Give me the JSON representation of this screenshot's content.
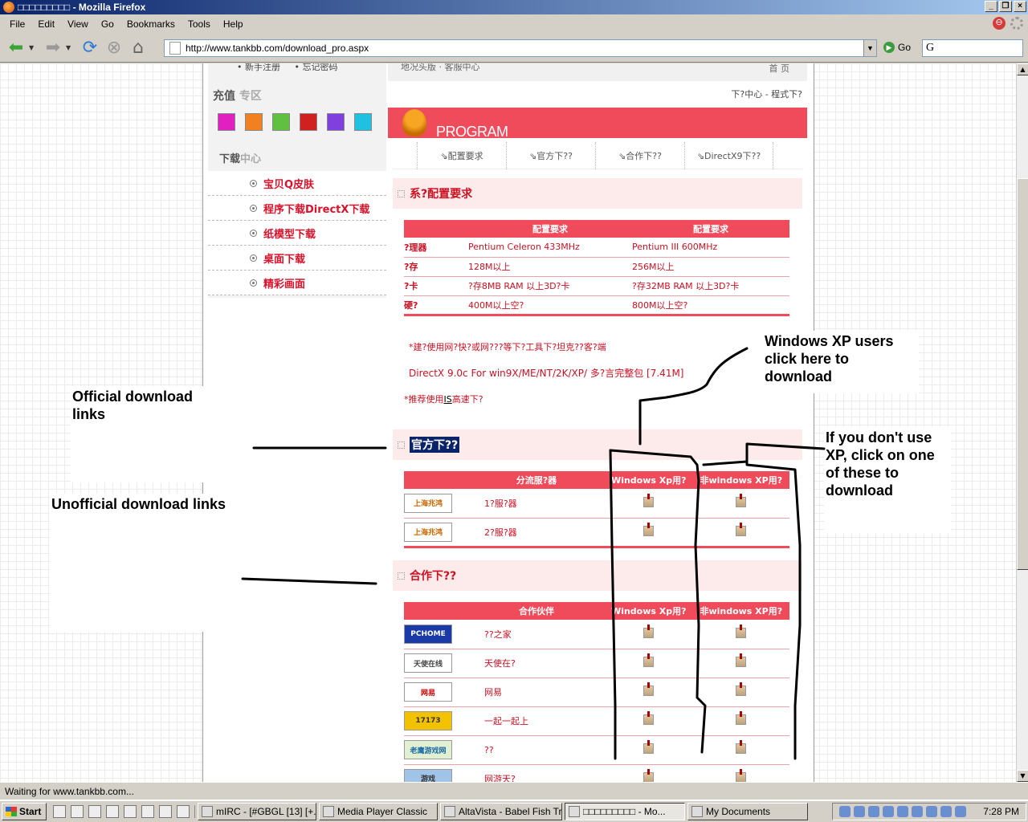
{
  "window": {
    "title": "□□□□□□□□□ - Mozilla Firefox"
  },
  "menu": {
    "items": [
      "File",
      "Edit",
      "View",
      "Go",
      "Bookmarks",
      "Tools",
      "Help"
    ]
  },
  "toolbar": {
    "url": "http://www.tankbb.com/download_pro.aspx",
    "go_label": "Go",
    "search_value": "G"
  },
  "sidebar": {
    "top_links": [
      "新手注册",
      "忘记密码"
    ],
    "recharge_title": "充值",
    "recharge_zone": "专区",
    "download_title": "下载",
    "download_title_cn": "中心",
    "items": [
      "宝贝Q皮肤",
      "程序下载DirectX下载",
      "纸模型下载",
      "桌面下载",
      "精彩画面"
    ]
  },
  "main": {
    "top_left": "地况头版 · 客服中心",
    "top_right": "首  页",
    "breadcrumb": "下?中心 - 程式下?",
    "banner_label": "PROGRAM",
    "tabs": [
      "配置要求",
      "官方下??",
      "合作下??",
      "DirectX9下??"
    ],
    "sec1_title": "系?配置要求",
    "sec1_headers": [
      "",
      "配置要求",
      "配置要求"
    ],
    "sec1_rows": [
      [
        "?理器",
        "Pentium Celeron 433MHz",
        "Pentium III 600MHz"
      ],
      [
        "?存",
        "128M以上",
        "256M以上"
      ],
      [
        "?卡",
        "?存8MB RAM 以上3D?卡",
        "?存32MB RAM 以上3D?卡"
      ],
      [
        "硬?",
        "400M以上空?",
        "800M以上空?"
      ]
    ],
    "note1": "*建?使用网?快?或网???等下?工具下?坦克??客?端",
    "note2": "DirectX 9.0c For win9X/ME/NT/2K/XP/ 多?言完整包 [7.41M]",
    "note3_pre": "*推荐使用",
    "note3_link": "IS",
    "note3_post": "高速下?",
    "sec2_title": "官方下??",
    "sec2_headers": [
      "",
      "分流服?器",
      "Windows Xp用?",
      "非windows XP用?"
    ],
    "sec2_rows": [
      {
        "logo": "上海兆鸿",
        "name": "1?服?器"
      },
      {
        "logo": "上海兆鸿",
        "name": "2?服?器"
      }
    ],
    "sec3_title": "合作下??",
    "sec3_headers": [
      "",
      "合作伙伴",
      "Windows Xp用?",
      "非windows XP用?"
    ],
    "sec3_rows": [
      {
        "logo": "PCHOME",
        "name": "??之家"
      },
      {
        "logo": "天使在线",
        "name": "天使在?"
      },
      {
        "logo": "网易",
        "name": "网易"
      },
      {
        "logo": "17173",
        "name": "一起一起上"
      },
      {
        "logo": "老鹰游戏网",
        "name": "??"
      },
      {
        "logo": "游戏",
        "name": "网游天?"
      }
    ]
  },
  "annotations": {
    "official": "Official download links",
    "unofficial": "Unofficial download links",
    "xp": "Windows XP users click here to download",
    "nonxp": "If you don't use XP, click on one of these to download"
  },
  "status": {
    "text": "Waiting for www.tankbb.com..."
  },
  "taskbar": {
    "start": "Start",
    "tasks": [
      "mIRC - [#GBGL [13] [+...",
      "Media Player Classic",
      "AltaVista - Babel Fish Tr...",
      "□□□□□□□□□ - Mo...",
      "My Documents"
    ],
    "clock": "7:28 PM"
  }
}
